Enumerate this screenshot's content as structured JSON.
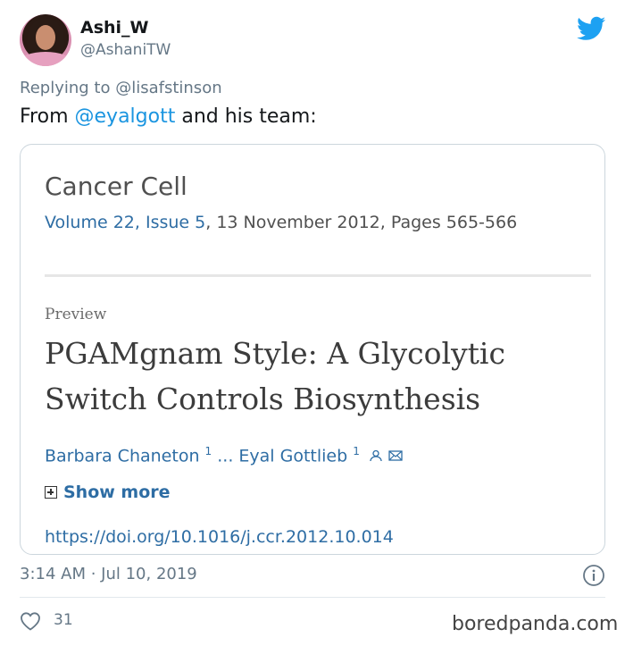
{
  "user": {
    "display_name": "Ashi_W",
    "handle": "@AshaniTW"
  },
  "reply": {
    "prefix": "Replying to",
    "mention": "@lisafstinson"
  },
  "tweet": {
    "prefix": "From",
    "mention": "@eyalgott",
    "suffix": "and his team:"
  },
  "card": {
    "journal": "Cancer Cell",
    "volume_link": "Volume 22, Issue 5",
    "volume_rest": ", 13 November 2012, Pages 565-566",
    "preview_label": "Preview",
    "title_line1": "PGAMgnam Style: A Glycolytic",
    "title_line2": "Switch Controls Biosynthesis",
    "author1": "Barbara Chaneton",
    "author1_sup": "1",
    "ellipsis": "...",
    "author2": "Eyal Gottlieb",
    "author2_sup": "1",
    "show_more": "Show more",
    "doi": "https://doi.org/10.1016/j.ccr.2012.10.014"
  },
  "meta": {
    "timestamp": "3:14 AM · Jul 10, 2019",
    "like_count": "31"
  },
  "watermark": "boredpanda.com",
  "colors": {
    "twitter_blue": "#1da1f2",
    "link_blue": "#2e6da4",
    "mention_blue": "#1b95e0",
    "muted_gray": "#657786"
  },
  "icons": [
    "twitter-bird-icon",
    "person-icon",
    "envelope-icon",
    "plus-box-icon",
    "info-icon",
    "heart-icon"
  ]
}
